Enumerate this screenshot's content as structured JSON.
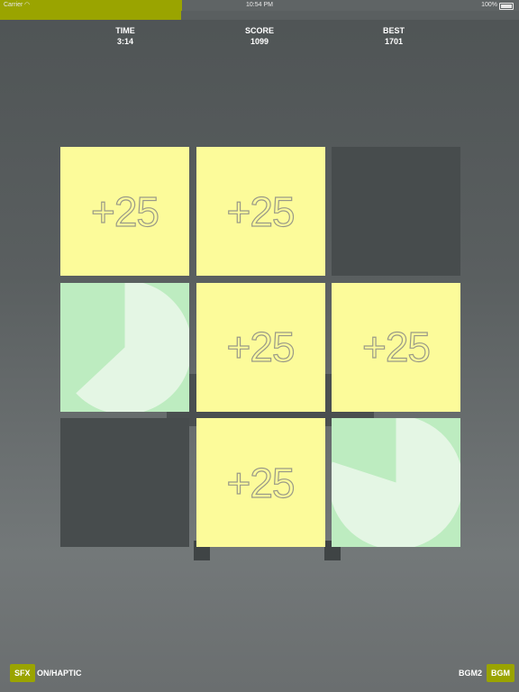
{
  "status_bar": {
    "carrier": "Carrier",
    "wifi_icon": "wifi-icon",
    "time": "10:54 PM",
    "battery_pct": "100%",
    "battery_icon": "battery-icon",
    "progress_color": "#9aa400",
    "progress_fraction": 0.35
  },
  "stats": {
    "time_label": "TIME",
    "time_value": "3:14",
    "score_label": "SCORE",
    "score_value": "1099",
    "best_label": "BEST",
    "best_value": "1701"
  },
  "board": {
    "rows": 3,
    "cols": 3,
    "tiles": [
      {
        "type": "plus",
        "text": "+25"
      },
      {
        "type": "plus",
        "text": "+25"
      },
      {
        "type": "empty",
        "text": ""
      },
      {
        "type": "pie",
        "text": "",
        "remaining_fraction": 0.63
      },
      {
        "type": "plus",
        "text": "+25"
      },
      {
        "type": "plus",
        "text": "+25"
      },
      {
        "type": "empty",
        "text": ""
      },
      {
        "type": "plus",
        "text": "+25"
      },
      {
        "type": "pie",
        "text": "",
        "remaining_fraction": 0.8
      }
    ],
    "colors": {
      "plus": "#fcfb9a",
      "empty": "#474c4d",
      "pie_bg": "#bdecc0",
      "pie_fill": "#e4f6e4"
    }
  },
  "footer": {
    "sfx_button": "SFX",
    "sfx_label": "ON/HAPTIC",
    "bgm_label": "BGM2",
    "bgm_button": "BGM",
    "accent": "#9aa400"
  }
}
